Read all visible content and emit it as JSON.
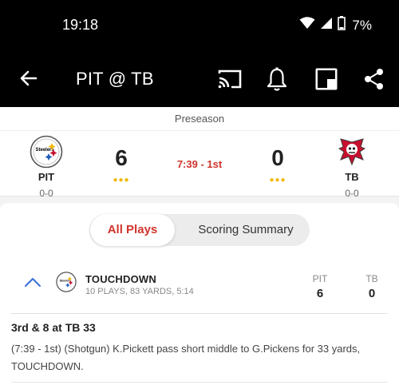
{
  "status_bar": {
    "time": "19:18",
    "battery": "7%"
  },
  "app_bar": {
    "title": "PIT @ TB",
    "icons": [
      "back-arrow-icon",
      "cast-icon",
      "bell-icon",
      "picture-in-picture-icon",
      "share-icon"
    ]
  },
  "scoreboard": {
    "season_type": "Preseason",
    "home": {
      "abbr": "PIT",
      "record": "0-0",
      "score": "6"
    },
    "away": {
      "abbr": "TB",
      "record": "0-0",
      "score": "0"
    },
    "clock": "7:39 - 1st",
    "dots": "●●●"
  },
  "tabs": {
    "all_plays": "All Plays",
    "scoring_summary": "Scoring Summary"
  },
  "scoring_play": {
    "title": "TOUCHDOWN",
    "detail": "10 PLAYS, 83 YARDS, 5:14",
    "team_a": "PIT",
    "team_b": "TB",
    "score_a": "6",
    "score_b": "0"
  },
  "play": {
    "down_distance": "3rd & 8 at TB 33",
    "description": "(7:39 - 1st) (Shotgun) K.Pickett pass short middle to G.Pickens for 33 yards, TOUCHDOWN."
  },
  "colors": {
    "accent_red": "#d0342c",
    "possession_yellow": "#f2b705",
    "chevron_blue": "#3a6fd8"
  }
}
